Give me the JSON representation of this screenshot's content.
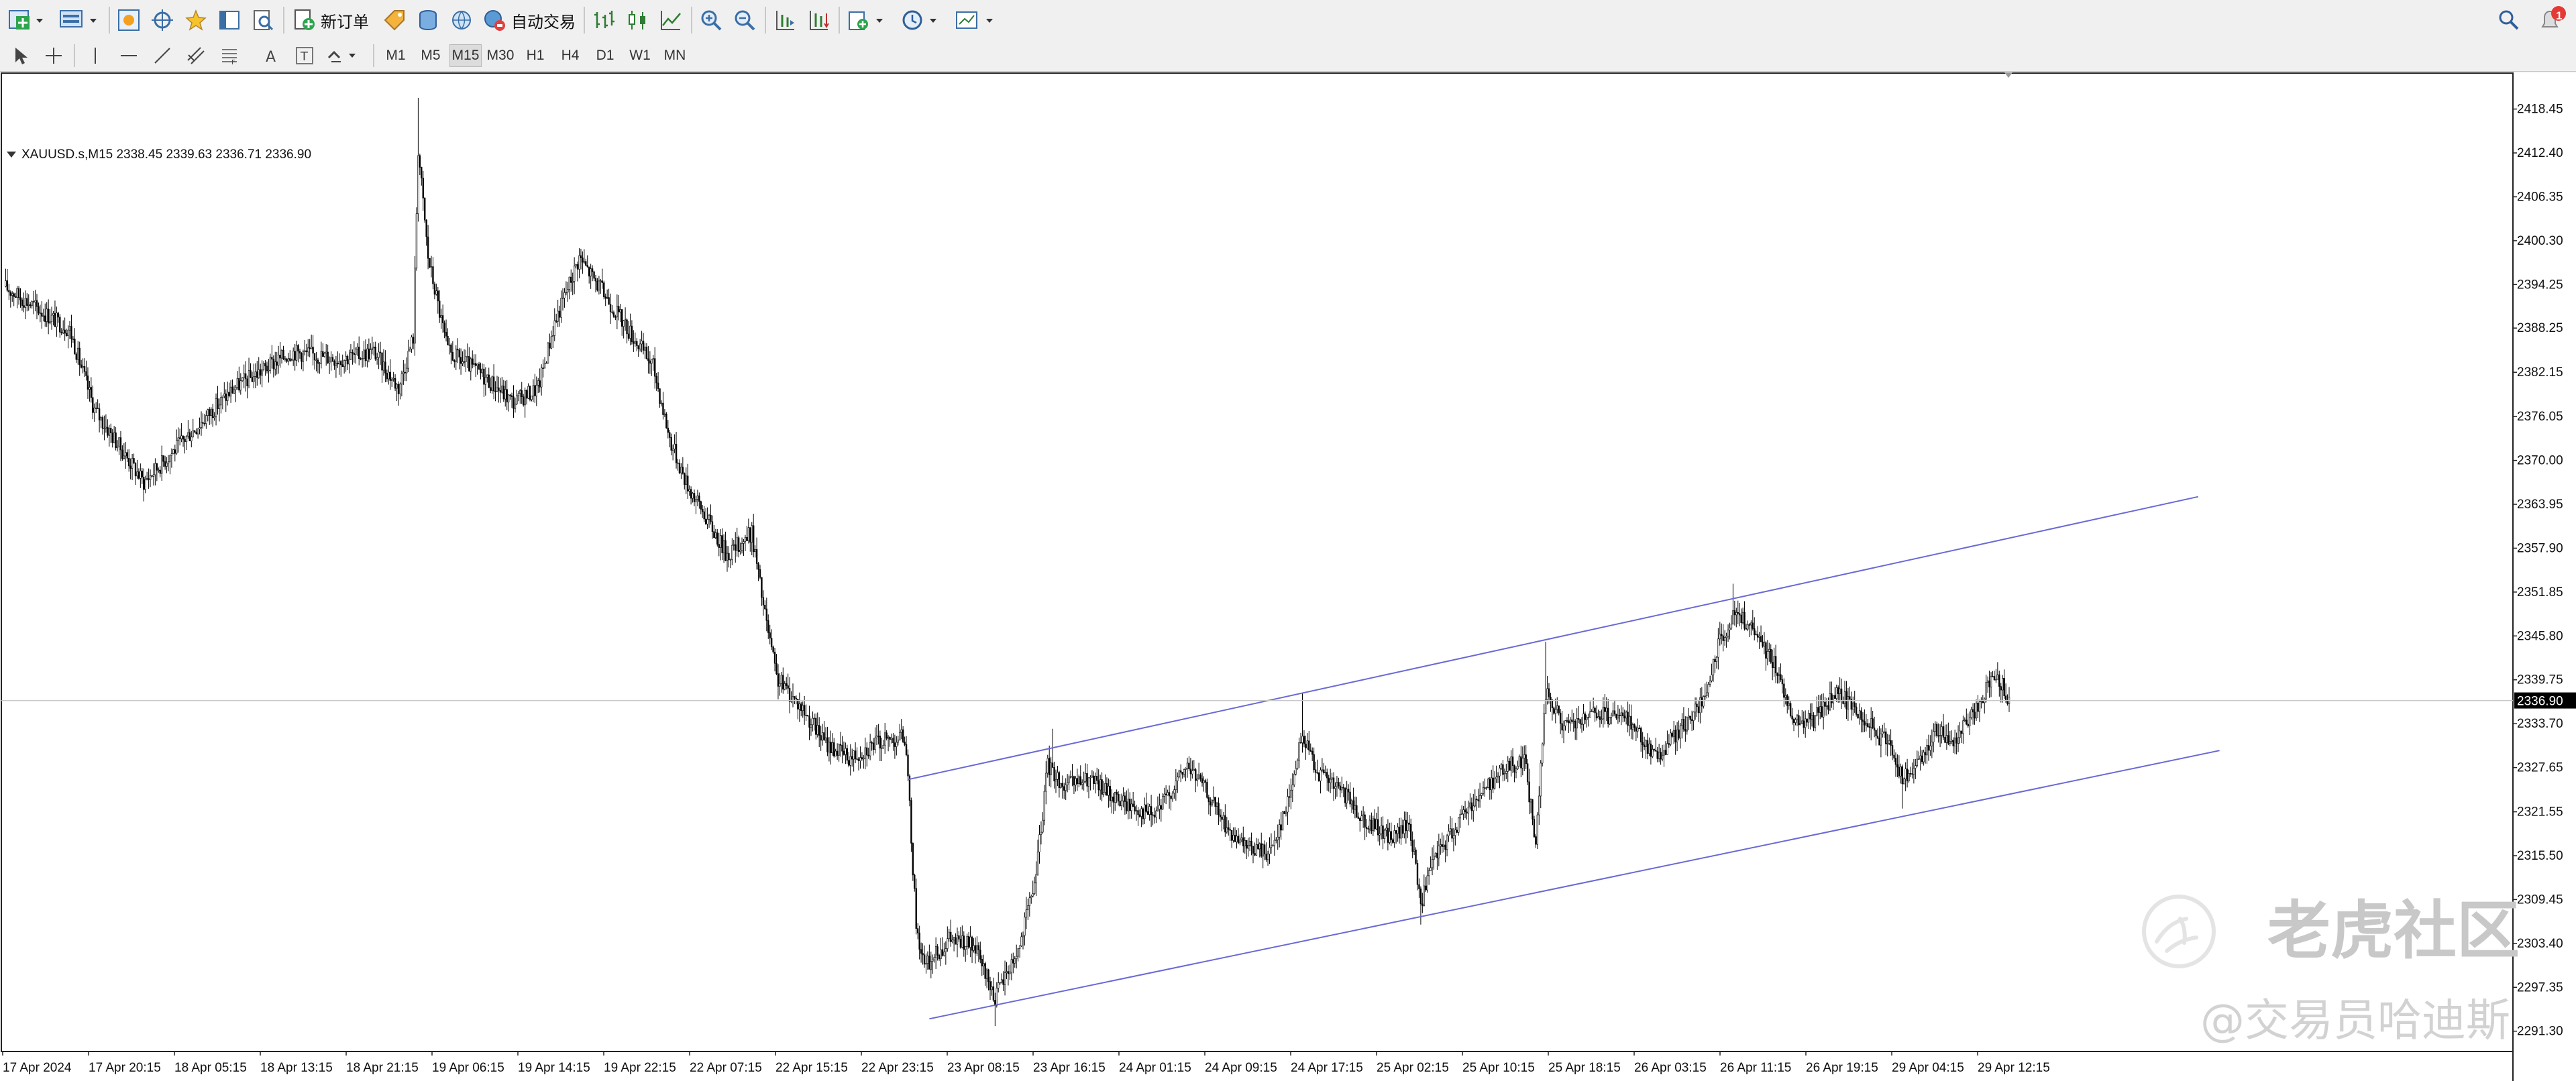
{
  "toolbar": {
    "new_order_label": "新订单",
    "auto_trade_label": "自动交易",
    "notification_count": "1"
  },
  "timeframes": [
    "M1",
    "M5",
    "M15",
    "M30",
    "H1",
    "H4",
    "D1",
    "W1",
    "MN"
  ],
  "active_timeframe": "M15",
  "symbol_info": "XAUUSD.s,M15  2338.45 2339.63 2336.71 2336.90",
  "watermark": {
    "logo_text": "老虎社区",
    "author_text": "@交易员哈迪斯"
  },
  "chart_data": {
    "type": "candlestick",
    "symbol": "XAUUSD.s",
    "timeframe": "M15",
    "ohlc_last": {
      "open": 2338.45,
      "high": 2339.63,
      "low": 2336.71,
      "close": 2336.9
    },
    "current_price": "2336.90",
    "ylim": [
      2288.5,
      2423.5
    ],
    "y_ticks": [
      "2418.45",
      "2412.40",
      "2406.35",
      "2400.30",
      "2394.25",
      "2388.25",
      "2382.15",
      "2376.05",
      "2370.00",
      "2363.95",
      "2357.90",
      "2351.85",
      "2345.80",
      "2339.75",
      "2333.70",
      "2327.65",
      "2321.55",
      "2315.50",
      "2309.45",
      "2303.40",
      "2297.35",
      "2291.30"
    ],
    "x_ticks": [
      "17 Apr 2024",
      "17 Apr 20:15",
      "18 Apr 05:15",
      "18 Apr 13:15",
      "18 Apr 21:15",
      "19 Apr 06:15",
      "19 Apr 14:15",
      "19 Apr 22:15",
      "22 Apr 07:15",
      "22 Apr 15:15",
      "22 Apr 23:15",
      "23 Apr 08:15",
      "23 Apr 16:15",
      "24 Apr 01:15",
      "24 Apr 09:15",
      "24 Apr 17:15",
      "25 Apr 02:15",
      "25 Apr 10:15",
      "25 Apr 18:15",
      "26 Apr 03:15",
      "26 Apr 11:15",
      "26 Apr 19:15",
      "29 Apr 04:15",
      "29 Apr 12:15"
    ],
    "price_path": [
      [
        0,
        2394
      ],
      [
        40,
        2388
      ],
      [
        55,
        2377
      ],
      [
        70,
        2372
      ],
      [
        85,
        2367
      ],
      [
        110,
        2373
      ],
      [
        140,
        2380
      ],
      [
        175,
        2385
      ],
      [
        205,
        2384
      ],
      [
        225,
        2385
      ],
      [
        240,
        2380
      ],
      [
        249,
        2387
      ],
      [
        252,
        2413
      ],
      [
        258,
        2398
      ],
      [
        270,
        2385
      ],
      [
        290,
        2382
      ],
      [
        310,
        2378
      ],
      [
        325,
        2380
      ],
      [
        335,
        2389
      ],
      [
        350,
        2398
      ],
      [
        365,
        2393
      ],
      [
        380,
        2388
      ],
      [
        395,
        2383
      ],
      [
        405,
        2373
      ],
      [
        415,
        2367
      ],
      [
        430,
        2361
      ],
      [
        440,
        2357
      ],
      [
        455,
        2360
      ],
      [
        462,
        2350
      ],
      [
        470,
        2340
      ],
      [
        485,
        2336
      ],
      [
        500,
        2331
      ],
      [
        515,
        2329
      ],
      [
        530,
        2331
      ],
      [
        548,
        2332
      ],
      [
        551,
        2322
      ],
      [
        555,
        2306
      ],
      [
        560,
        2300
      ],
      [
        575,
        2304
      ],
      [
        590,
        2303
      ],
      [
        603,
        2296
      ],
      [
        618,
        2303
      ],
      [
        628,
        2313
      ],
      [
        635,
        2328
      ],
      [
        645,
        2325
      ],
      [
        660,
        2326
      ],
      [
        680,
        2323
      ],
      [
        700,
        2321
      ],
      [
        720,
        2328
      ],
      [
        730,
        2325
      ],
      [
        750,
        2317
      ],
      [
        770,
        2316
      ],
      [
        780,
        2322
      ],
      [
        790,
        2332
      ],
      [
        800,
        2327
      ],
      [
        815,
        2324
      ],
      [
        830,
        2320
      ],
      [
        845,
        2318
      ],
      [
        855,
        2320
      ],
      [
        862,
        2309
      ],
      [
        870,
        2315
      ],
      [
        890,
        2322
      ],
      [
        910,
        2327
      ],
      [
        925,
        2329
      ],
      [
        932,
        2317
      ],
      [
        938,
        2338
      ],
      [
        950,
        2333
      ],
      [
        970,
        2335
      ],
      [
        990,
        2334
      ],
      [
        1005,
        2329
      ],
      [
        1020,
        2333
      ],
      [
        1035,
        2337
      ],
      [
        1045,
        2346
      ],
      [
        1055,
        2349
      ],
      [
        1065,
        2346
      ],
      [
        1075,
        2343
      ],
      [
        1085,
        2337
      ],
      [
        1090,
        2334
      ],
      [
        1100,
        2334
      ],
      [
        1115,
        2338
      ],
      [
        1130,
        2335
      ],
      [
        1140,
        2332
      ],
      [
        1148,
        2331
      ],
      [
        1155,
        2326
      ],
      [
        1165,
        2328
      ],
      [
        1175,
        2333
      ],
      [
        1185,
        2331
      ],
      [
        1195,
        2334
      ],
      [
        1205,
        2338
      ],
      [
        1212,
        2341
      ],
      [
        1220,
        2337
      ]
    ],
    "channel_lines": [
      {
        "name": "upper",
        "points": [
          [
            550,
            2326
          ],
          [
            1335,
            2365
          ]
        ]
      },
      {
        "name": "lower",
        "points": [
          [
            563,
            2293
          ],
          [
            1348,
            2330
          ]
        ]
      }
    ]
  }
}
